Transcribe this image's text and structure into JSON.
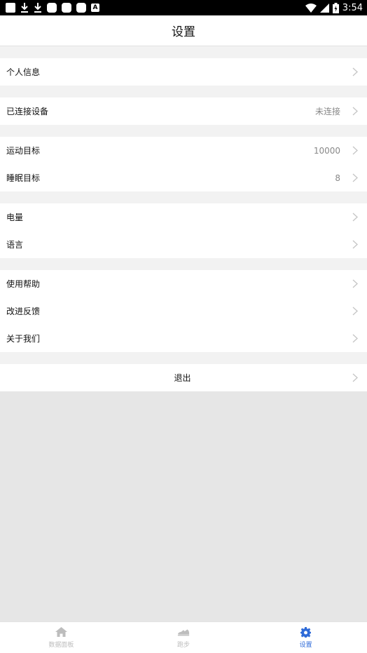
{
  "status_bar": {
    "time": "3:54"
  },
  "header": {
    "title": "设置"
  },
  "settings": {
    "profile": {
      "label": "个人信息"
    },
    "device": {
      "label": "已连接设备",
      "value": "未连接"
    },
    "exercise_goal": {
      "label": "运动目标",
      "value": "10000"
    },
    "sleep_goal": {
      "label": "睡眠目标",
      "value": "8"
    },
    "battery": {
      "label": "电量"
    },
    "language": {
      "label": "语言"
    },
    "help": {
      "label": "使用帮助"
    },
    "feedback": {
      "label": "改进反馈"
    },
    "about": {
      "label": "关于我们"
    },
    "logout": {
      "label": "退出"
    }
  },
  "tabs": [
    {
      "label": "数据面板",
      "icon": "home-icon"
    },
    {
      "label": "跑步",
      "icon": "running-shoe-icon"
    },
    {
      "label": "设置",
      "icon": "gear-icon",
      "active": true
    }
  ],
  "colors": {
    "accent": "#2f6bd8",
    "background": "#e6e6e6",
    "section_gap": "#f2f2f2"
  }
}
